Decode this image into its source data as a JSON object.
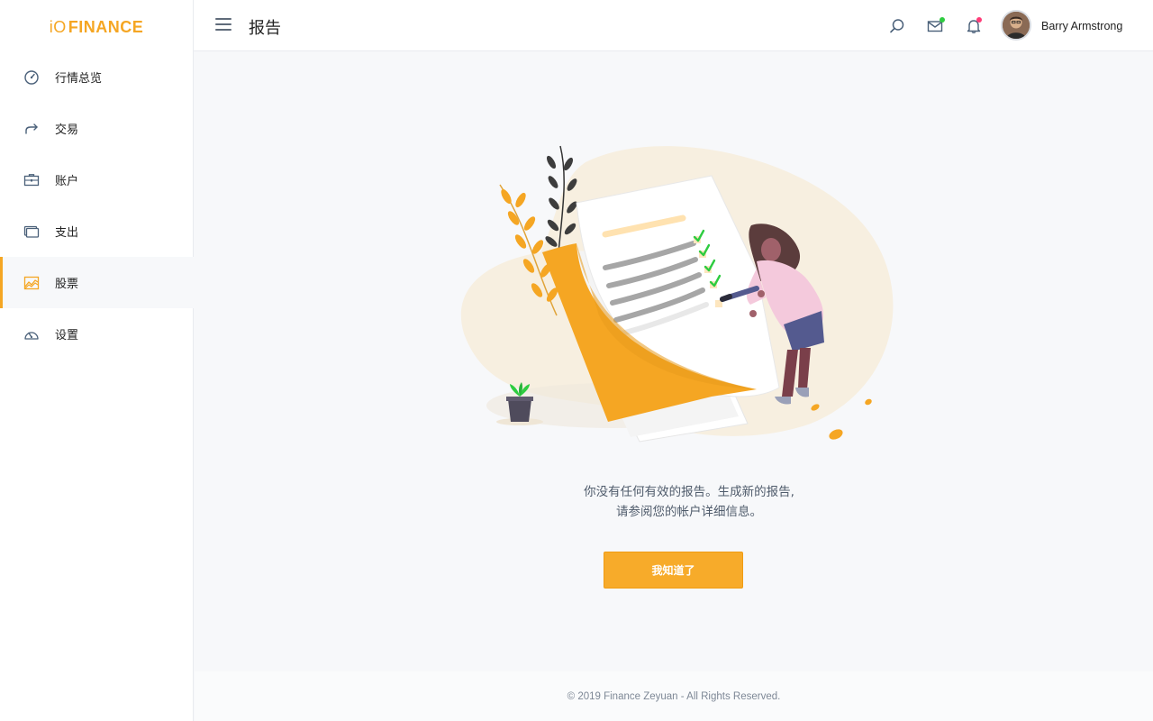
{
  "brand": {
    "prefix": "iO",
    "name": "FINANCE"
  },
  "sidebar": {
    "items": [
      {
        "label": "行情总览",
        "icon": "gauge-icon"
      },
      {
        "label": "交易",
        "icon": "share-arrow-icon"
      },
      {
        "label": "账户",
        "icon": "briefcase-icon"
      },
      {
        "label": "支出",
        "icon": "wallet-icon"
      },
      {
        "label": "股票",
        "icon": "chart-area-icon",
        "active": true
      },
      {
        "label": "设置",
        "icon": "speedometer-icon"
      }
    ]
  },
  "header": {
    "title": "报告",
    "user_name": "Barry Armstrong",
    "icons": [
      "search-icon",
      "mail-icon",
      "bell-icon"
    ]
  },
  "empty_state": {
    "line1": "你没有任何有效的报告。生成新的报告,",
    "line2": "请参阅您的帐户详细信息。",
    "button_label": "我知道了"
  },
  "footer": {
    "text": "© 2019 Finance Zeyuan - All Rights Reserved."
  },
  "colors": {
    "accent": "#f5a623",
    "mail_badge": "#2ecc40",
    "bell_badge": "#ff3c78"
  }
}
